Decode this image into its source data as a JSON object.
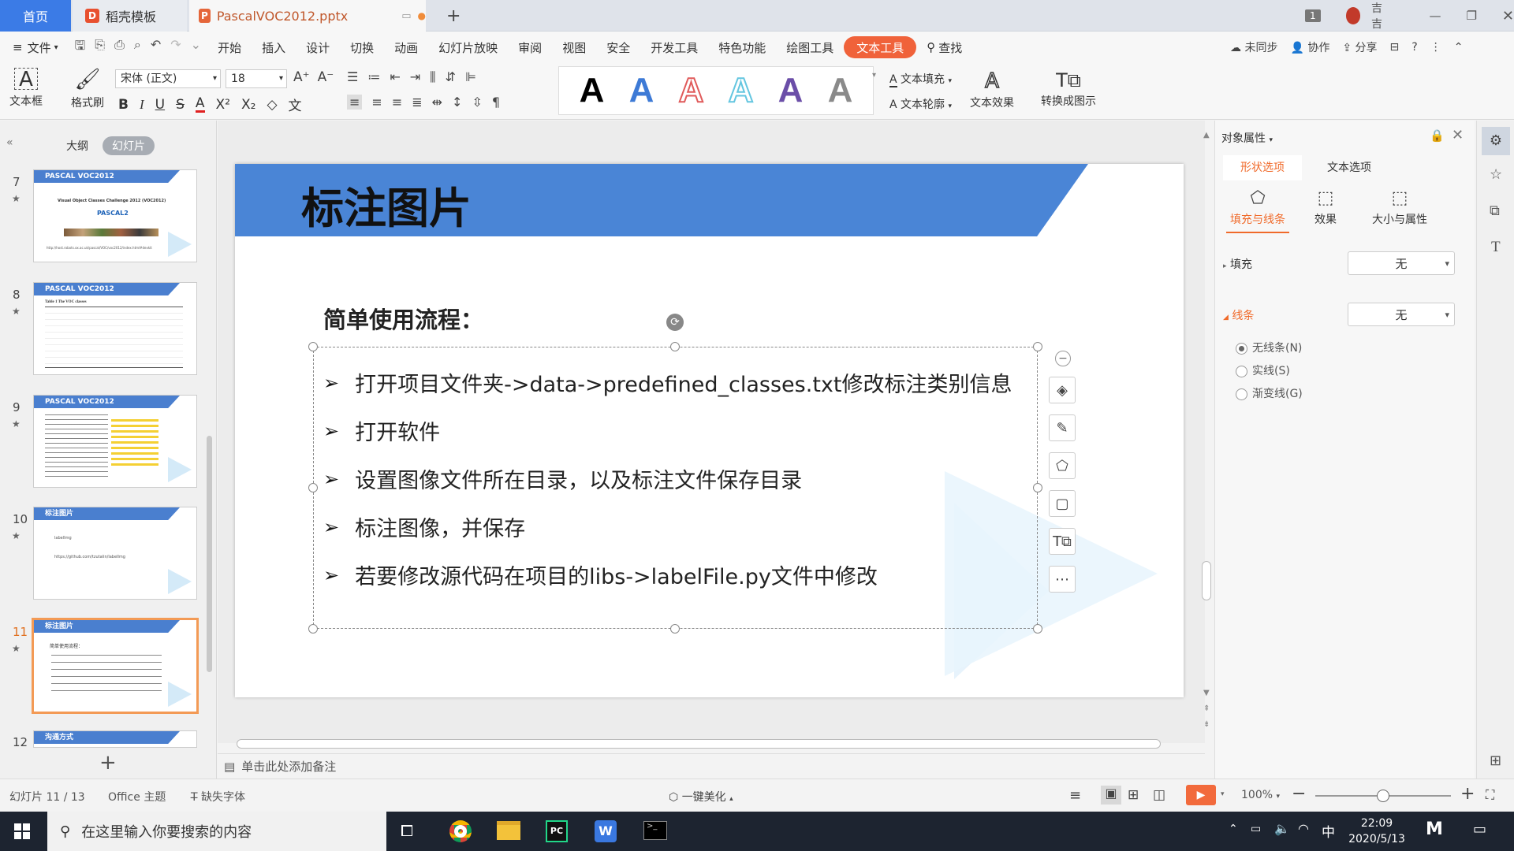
{
  "tabs": {
    "home": "首页",
    "template": "稻壳模板",
    "file": "PascalVOC2012.pptx",
    "new_tab": "+",
    "badge": "1",
    "user": "吉吉"
  },
  "menu": {
    "file": "文件",
    "items": [
      "开始",
      "插入",
      "设计",
      "切换",
      "动画",
      "幻灯片放映",
      "审阅",
      "视图",
      "安全",
      "开发工具",
      "特色功能",
      "绘图工具"
    ],
    "active": "文本工具",
    "search": "查找",
    "sync": "未同步",
    "collab": "协作",
    "share": "分享"
  },
  "ribbon": {
    "textbox": "文本框",
    "format_painter": "格式刷",
    "font_name": "宋体 (正文)",
    "font_size": "18",
    "text_fill": "文本填充",
    "text_outline": "文本轮廓",
    "text_effect": "文本效果",
    "convert": "转换成图示",
    "wordart_glyph": "A"
  },
  "leftpane": {
    "tab_outline": "大纲",
    "tab_slides": "幻灯片",
    "slides": [
      {
        "num": "7",
        "title": "PASCAL VOC2012",
        "sub": "Visual Object Classes Challenge 2012 (VOC2012)",
        "logo": "PASCAL2",
        "url": "http://host.robots.ox.ac.uk/pascal/VOC/voc2012/index.html#devkit"
      },
      {
        "num": "8",
        "title": "PASCAL VOC2012",
        "sub": "Table 1  The VOC classes"
      },
      {
        "num": "9",
        "title": "PASCAL VOC2012",
        "sub": ""
      },
      {
        "num": "10",
        "title": "标注图片",
        "sub": "labelImg",
        "url": "https://github.com/tzutalin/labelImg"
      },
      {
        "num": "11",
        "title": "标注图片",
        "sub": "简单使用流程："
      },
      {
        "num": "12",
        "title": "沟通方式",
        "sub": ""
      }
    ],
    "add": "+"
  },
  "slide": {
    "title": "标注图片",
    "heading": "简单使用流程：",
    "bullets": [
      "打开项目文件夹->data->predefined_classes.txt修改标注类别信息",
      "打开软件",
      "设置图像文件所在目录，以及标注文件保存目录",
      "标注图像，并保存",
      "若要修改源代码在项目的libs->labelFile.py文件中修改"
    ]
  },
  "notes_placeholder": "单击此处添加备注",
  "rightpane": {
    "title": "对象属性",
    "tab_shape": "形状选项",
    "tab_text": "文本选项",
    "sub_fill_line": "填充与线条",
    "sub_effect": "效果",
    "sub_size": "大小与属性",
    "fill_label": "填充",
    "fill_value": "无",
    "line_label": "线条",
    "line_value": "无",
    "line_options": [
      "无线条(N)",
      "实线(S)",
      "渐变线(G)"
    ]
  },
  "status": {
    "slide_info": "幻灯片 11 / 13",
    "theme": "Office 主题",
    "missing_font": "缺失字体",
    "beautify": "一键美化",
    "zoom": "100%",
    "zoom_level": 0.5
  },
  "taskbar": {
    "search_placeholder": "在这里输入你要搜索的内容",
    "time": "22:09",
    "date": "2020/5/13",
    "ime": "中"
  },
  "colors": {
    "accent": "#3b7be6",
    "active_tab": "#f0623a",
    "slide_banner": "#4a7fcf",
    "selected_thumb": "#f39a55",
    "play_button": "#f26a3c"
  }
}
